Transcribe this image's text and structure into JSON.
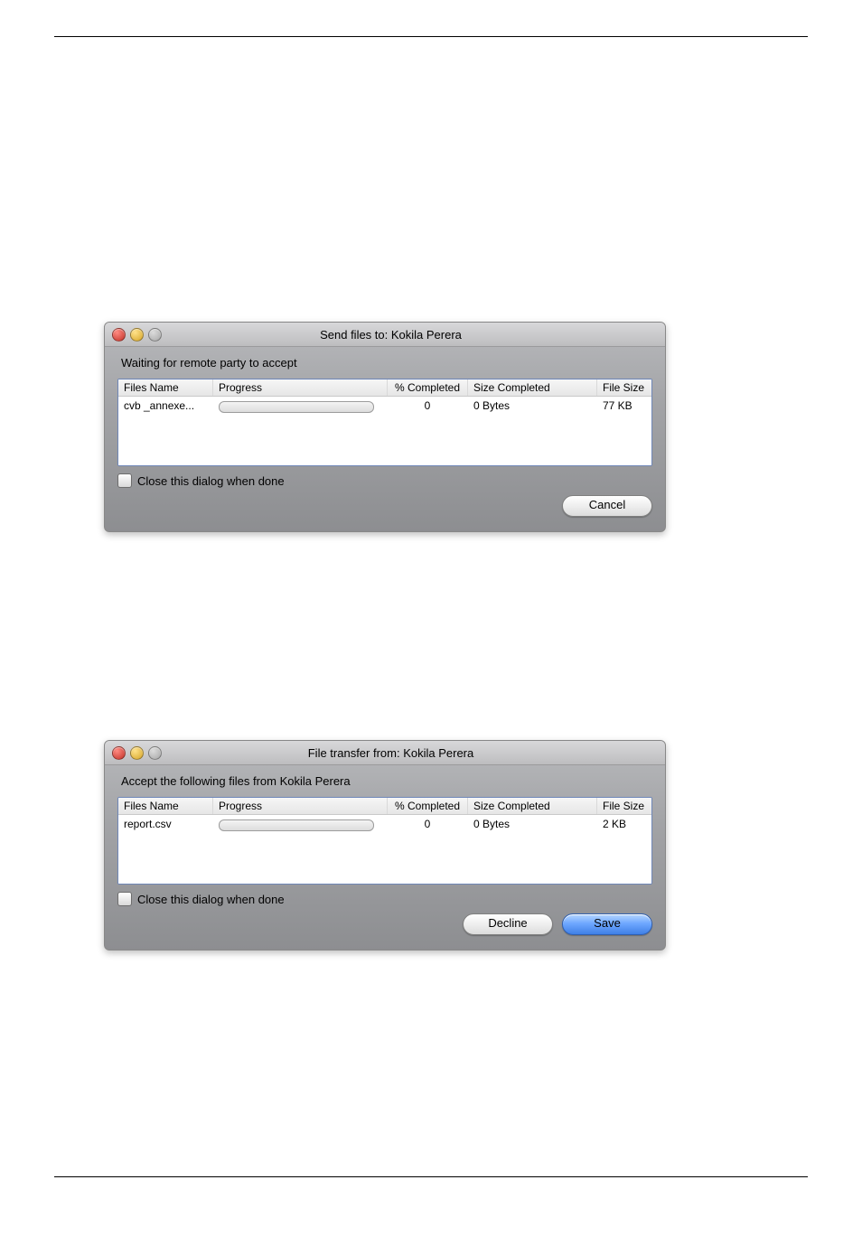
{
  "dialog1": {
    "title": "Send files to:  Kokila Perera",
    "status": "Waiting for remote party to accept",
    "columns": {
      "name": "Files Name",
      "progress": "Progress",
      "pct": "% Completed",
      "size": "Size Completed",
      "fsize": "File Size"
    },
    "rows": [
      {
        "name": "cvb _annexe...",
        "pct": "0",
        "size": "0 Bytes",
        "fsize": "77 KB"
      }
    ],
    "checkbox_label": "Close this dialog when done",
    "buttons": {
      "cancel": "Cancel"
    }
  },
  "dialog2": {
    "title": "File transfer from:  Kokila Perera",
    "status": "Accept the following files from  Kokila Perera",
    "columns": {
      "name": "Files Name",
      "progress": "Progress",
      "pct": "% Completed",
      "size": "Size Completed",
      "fsize": "File Size"
    },
    "rows": [
      {
        "name": "report.csv",
        "pct": "0",
        "size": "0 Bytes",
        "fsize": "2 KB"
      }
    ],
    "checkbox_label": "Close this dialog when done",
    "buttons": {
      "decline": "Decline",
      "save": "Save"
    }
  }
}
